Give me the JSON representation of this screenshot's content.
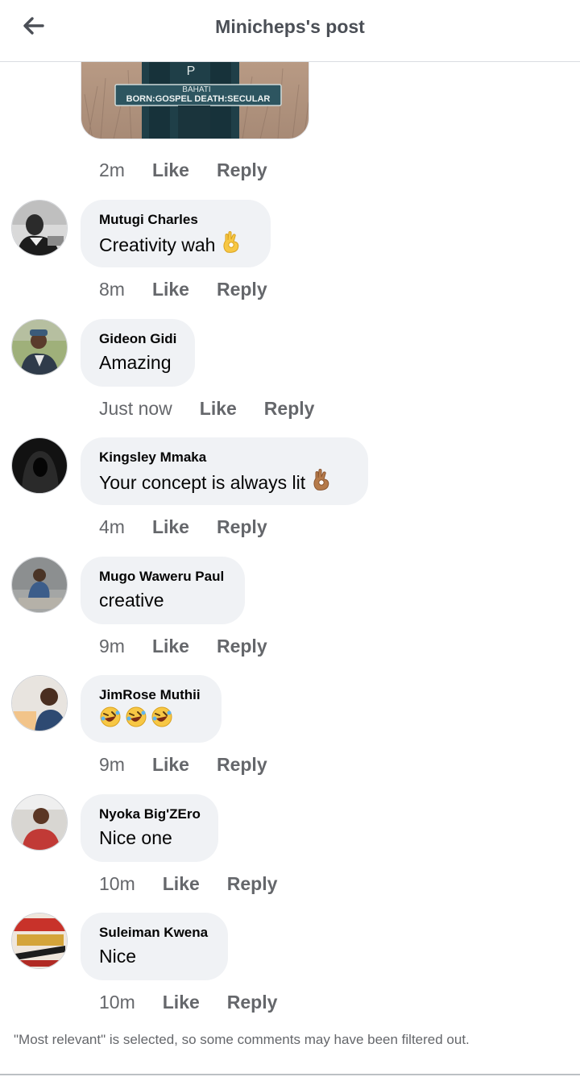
{
  "header": {
    "title": "Minicheps's post",
    "back_icon": "arrow-left-icon"
  },
  "first_comment": {
    "image_sign_letter": "P",
    "image_sign_name": "BAHATI",
    "image_sign_caption": "BORN:GOSPEL DEATH:SECULAR",
    "time": "2m",
    "like": "Like",
    "reply": "Reply"
  },
  "comments": [
    {
      "name": "Mutugi Charles",
      "text": "Creativity wah",
      "emoji": "ok-hand-light",
      "time": "8m",
      "like": "Like",
      "reply": "Reply"
    },
    {
      "name": "Gideon Gidi",
      "text": "Amazing",
      "emoji": "",
      "time": "Just now",
      "like": "Like",
      "reply": "Reply"
    },
    {
      "name": "Kingsley Mmaka",
      "text": "Your concept is always lit",
      "emoji": "ok-hand-medium",
      "time": "4m",
      "like": "Like",
      "reply": "Reply"
    },
    {
      "name": "Mugo Waweru Paul",
      "text": "creative",
      "emoji": "",
      "time": "9m",
      "like": "Like",
      "reply": "Reply"
    },
    {
      "name": "JimRose Muthii",
      "text": "",
      "emoji": "rofl-x3",
      "time": "9m",
      "like": "Like",
      "reply": "Reply"
    },
    {
      "name": "Nyoka Big'ZEro",
      "text": "Nice one",
      "emoji": "",
      "time": "10m",
      "like": "Like",
      "reply": "Reply"
    },
    {
      "name": "Suleiman Kwena",
      "text": "Nice",
      "emoji": "",
      "time": "10m",
      "like": "Like",
      "reply": "Reply"
    }
  ],
  "footer": {
    "note": "\"Most relevant\" is selected, so some comments may have been filtered out."
  },
  "colors": {
    "bubble": "#f0f2f5",
    "meta_text": "#65676b",
    "title_text": "#4b4f56"
  }
}
